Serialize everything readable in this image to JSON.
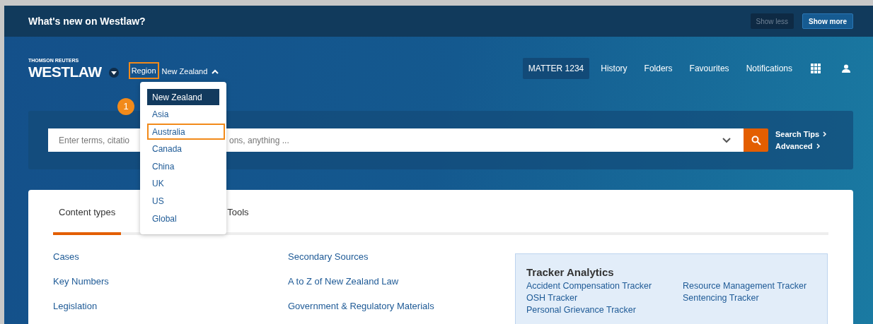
{
  "banner": {
    "title": "What's new on Westlaw?",
    "buttons": [
      {
        "label": "Show less",
        "disabled": true
      },
      {
        "label": "Show more",
        "disabled": false
      }
    ]
  },
  "logo": {
    "brand": "THOMSON REUTERS",
    "product": "WESTLAW"
  },
  "region": {
    "label": "Region",
    "value": "New Zealand",
    "expanded": true,
    "highlighted": true,
    "step": "1",
    "options": [
      {
        "label": "New Zealand",
        "selected": true,
        "highlighted": false
      },
      {
        "label": "Asia",
        "selected": false,
        "highlighted": false
      },
      {
        "label": "Australia",
        "selected": false,
        "highlighted": true
      },
      {
        "label": "Canada",
        "selected": false,
        "highlighted": false
      },
      {
        "label": "China",
        "selected": false,
        "highlighted": false
      },
      {
        "label": "UK",
        "selected": false,
        "highlighted": false
      },
      {
        "label": "US",
        "selected": false,
        "highlighted": false
      },
      {
        "label": "Global",
        "selected": false,
        "highlighted": false
      }
    ]
  },
  "nav": [
    {
      "label": "MATTER 1234",
      "kind": "matter"
    },
    {
      "label": "History",
      "kind": "link"
    },
    {
      "label": "Folders",
      "kind": "link"
    },
    {
      "label": "Favourites",
      "kind": "link"
    },
    {
      "label": "Notifications",
      "kind": "link"
    },
    {
      "kind": "apps"
    },
    {
      "kind": "user"
    }
  ],
  "search": {
    "placeholder_parts": [
      "Enter terms, citatio",
      "ons, anything ..."
    ],
    "links": [
      "Search Tips",
      "Advanced"
    ]
  },
  "tabs": [
    {
      "label": "Content types",
      "selected": true
    },
    {
      "label": "Tools",
      "selected": false
    }
  ],
  "content_links": [
    [
      "Cases",
      "Key Numbers",
      "Legislation"
    ],
    [
      "Secondary Sources",
      "A to Z of New Zealand Law",
      "Government & Regulatory Materials"
    ]
  ],
  "tracker": {
    "title": "Tracker Analytics",
    "columns": [
      [
        "Accident Compensation Tracker",
        "OSH Tracker",
        "Personal Grievance Tracker"
      ],
      [
        "Resource Management Tracker",
        "Sentencing Tracker"
      ]
    ]
  }
}
